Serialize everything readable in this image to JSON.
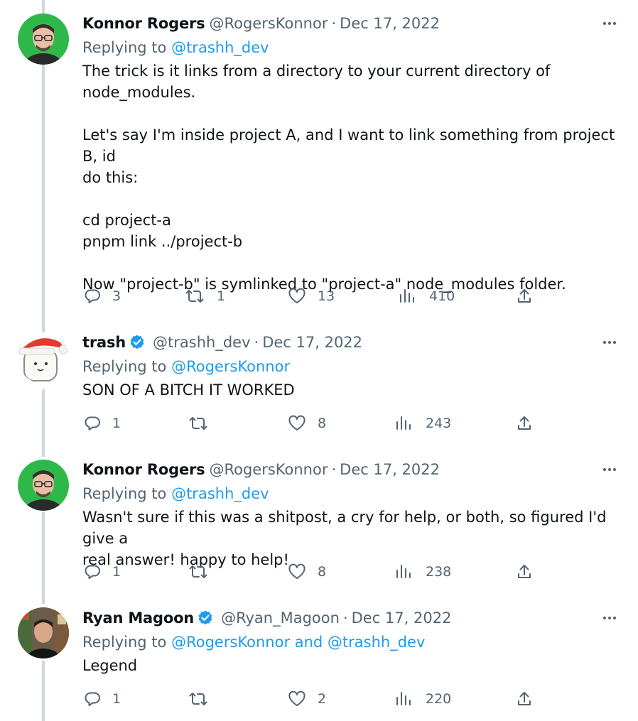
{
  "tweets": [
    {
      "name": "Konnor Rogers",
      "handle": "@RogersKonnor",
      "separator": "·",
      "date": "Dec 17, 2022",
      "verified": false,
      "replying_prefix": "Replying to ",
      "replying_to": "@trashh_dev",
      "paragraphs": [
        "The trick is it links from a directory to your current directory of\nnode_modules.",
        "Let's say I'm inside project A, and I want to link something from project B, id\ndo this:",
        "cd project-a\npnpm link ../project-b",
        "Now \"project-b\" is symlinked to \"project-a\" node_modules folder."
      ],
      "stats": {
        "replies": "3",
        "retweets": "1",
        "likes": "13",
        "views": "410"
      },
      "avatar": "green-avatar-glasses"
    },
    {
      "name": "trash",
      "handle": "@trashh_dev",
      "separator": "·",
      "date": "Dec 17, 2022",
      "verified": true,
      "replying_prefix": "Replying to ",
      "replying_to": "@RogersKonnor",
      "paragraphs": [
        "SON OF A BITCH IT WORKED"
      ],
      "stats": {
        "replies": "1",
        "retweets": "",
        "likes": "8",
        "views": "243"
      },
      "avatar": "santa-hat-avatar"
    },
    {
      "name": "Konnor Rogers",
      "handle": "@RogersKonnor",
      "separator": "·",
      "date": "Dec 17, 2022",
      "verified": false,
      "replying_prefix": "Replying to ",
      "replying_to": "@trashh_dev",
      "paragraphs": [
        "Wasn't sure if this was a shitpost, a cry for help, or both, so figured I'd give a\nreal answer! happy to help!"
      ],
      "stats": {
        "replies": "1",
        "retweets": "",
        "likes": "8",
        "views": "238"
      },
      "avatar": "green-avatar-glasses"
    },
    {
      "name": "Ryan Magoon",
      "handle": "@Ryan_Magoon",
      "separator": "·",
      "date": "Dec 17, 2022",
      "verified": true,
      "replying_prefix": "Replying to ",
      "replying_to": "@RogersKonnor and @trashh_dev",
      "paragraphs": [
        "Legend"
      ],
      "stats": {
        "replies": "1",
        "retweets": "",
        "likes": "2",
        "views": "220"
      },
      "avatar": "photo-avatar"
    }
  ],
  "icons": {
    "reply": "reply-icon",
    "retweet": "retweet-icon",
    "like": "heart-icon",
    "views": "views-icon",
    "share": "share-icon",
    "more": "more-icon",
    "verified": "verified-badge-icon"
  },
  "colors": {
    "text": "#0f1419",
    "muted": "#536471",
    "link": "#1d9bf0",
    "verified": "#1d9bf0",
    "thread_line": "#cfd9de"
  }
}
